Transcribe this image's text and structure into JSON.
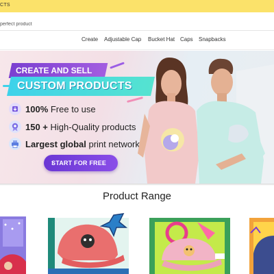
{
  "announcement": {
    "text": "CTS"
  },
  "search": {
    "placeholder": "perfect product"
  },
  "nav": {
    "items": [
      "Create",
      "Adjustable Cap",
      "Bucket Hat",
      "Caps",
      "Snapbacks"
    ]
  },
  "hero": {
    "headline_1": "CREATE AND SELL",
    "headline_2": "CUSTOM PRODUCTS",
    "features": [
      {
        "icon": "download-icon",
        "bold": "100%",
        "rest": " Free to use"
      },
      {
        "icon": "badge-icon",
        "bold": "150 +",
        "rest": " High-Quality products"
      },
      {
        "icon": "printer-icon",
        "bold": "Largest global",
        "rest": " print network"
      }
    ],
    "cta_label": "START FOR FREE"
  },
  "product_range": {
    "title": "Product Range"
  },
  "colors": {
    "top_bar": "#fbe26a",
    "banner_purple": "#7b3fd1",
    "banner_teal": "#3ed2ea",
    "cta_purple": "#6a37d4"
  }
}
